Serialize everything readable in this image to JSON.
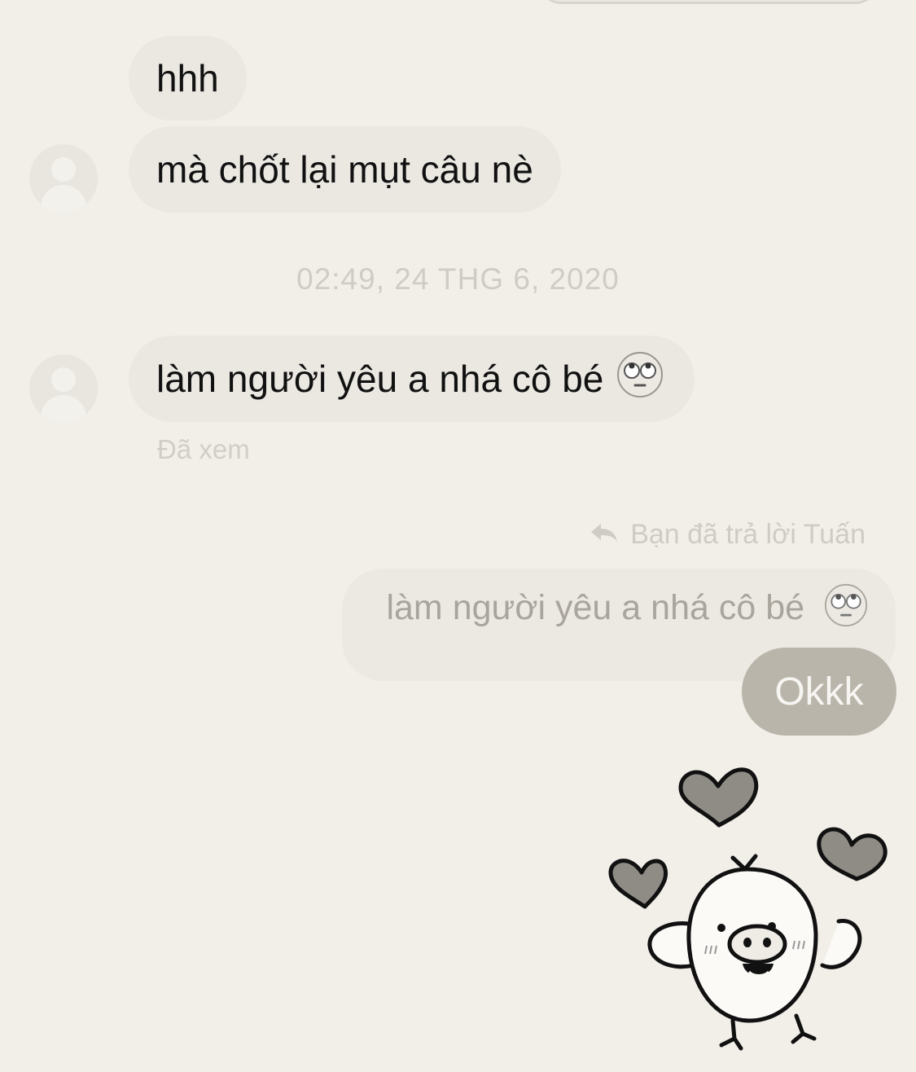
{
  "messages": {
    "incoming_1": "hhh",
    "incoming_2": "mà chốt lại mụt câu nè",
    "incoming_3": "làm người yêu a nhá cô bé",
    "incoming_3_emoji": "face-with-rolling-eyes-icon"
  },
  "timestamp": "02:49, 24 THG 6, 2020",
  "seen_label": "Đã xem",
  "reply": {
    "note": "Bạn đã trả lời Tuấn",
    "quoted_text": "làm người yêu a nhá cô bé",
    "quoted_emoji": "face-with-rolling-eyes-icon",
    "sent_text": "Okkk"
  },
  "sticker": "chick-with-hearts-sticker",
  "colors": {
    "background": "#f2efe9",
    "incoming_bubble": "#ebe8e2",
    "outgoing_bubble": "#b9b5aa",
    "muted_text": "#cfccc6"
  }
}
